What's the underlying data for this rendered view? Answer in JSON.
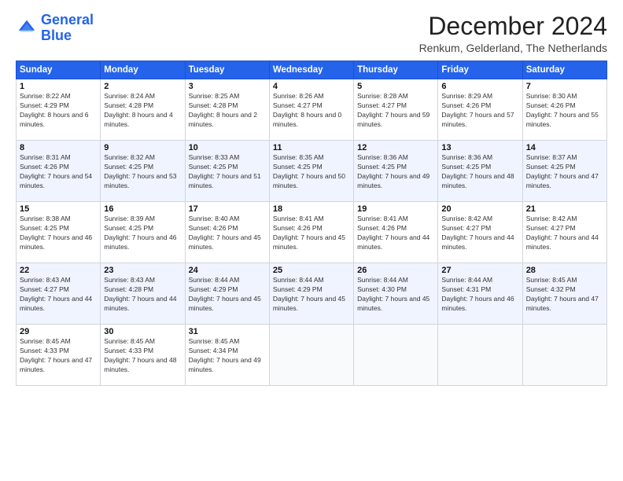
{
  "header": {
    "logo_line1": "General",
    "logo_line2": "Blue",
    "title": "December 2024",
    "location": "Renkum, Gelderland, The Netherlands"
  },
  "days_of_week": [
    "Sunday",
    "Monday",
    "Tuesday",
    "Wednesday",
    "Thursday",
    "Friday",
    "Saturday"
  ],
  "weeks": [
    [
      {
        "day": "1",
        "rise": "8:22 AM",
        "set": "4:29 PM",
        "daylight": "8 hours and 6 minutes."
      },
      {
        "day": "2",
        "rise": "8:24 AM",
        "set": "4:28 PM",
        "daylight": "8 hours and 4 minutes."
      },
      {
        "day": "3",
        "rise": "8:25 AM",
        "set": "4:28 PM",
        "daylight": "8 hours and 2 minutes."
      },
      {
        "day": "4",
        "rise": "8:26 AM",
        "set": "4:27 PM",
        "daylight": "8 hours and 0 minutes."
      },
      {
        "day": "5",
        "rise": "8:28 AM",
        "set": "4:27 PM",
        "daylight": "7 hours and 59 minutes."
      },
      {
        "day": "6",
        "rise": "8:29 AM",
        "set": "4:26 PM",
        "daylight": "7 hours and 57 minutes."
      },
      {
        "day": "7",
        "rise": "8:30 AM",
        "set": "4:26 PM",
        "daylight": "7 hours and 55 minutes."
      }
    ],
    [
      {
        "day": "8",
        "rise": "8:31 AM",
        "set": "4:26 PM",
        "daylight": "7 hours and 54 minutes."
      },
      {
        "day": "9",
        "rise": "8:32 AM",
        "set": "4:25 PM",
        "daylight": "7 hours and 53 minutes."
      },
      {
        "day": "10",
        "rise": "8:33 AM",
        "set": "4:25 PM",
        "daylight": "7 hours and 51 minutes."
      },
      {
        "day": "11",
        "rise": "8:35 AM",
        "set": "4:25 PM",
        "daylight": "7 hours and 50 minutes."
      },
      {
        "day": "12",
        "rise": "8:36 AM",
        "set": "4:25 PM",
        "daylight": "7 hours and 49 minutes."
      },
      {
        "day": "13",
        "rise": "8:36 AM",
        "set": "4:25 PM",
        "daylight": "7 hours and 48 minutes."
      },
      {
        "day": "14",
        "rise": "8:37 AM",
        "set": "4:25 PM",
        "daylight": "7 hours and 47 minutes."
      }
    ],
    [
      {
        "day": "15",
        "rise": "8:38 AM",
        "set": "4:25 PM",
        "daylight": "7 hours and 46 minutes."
      },
      {
        "day": "16",
        "rise": "8:39 AM",
        "set": "4:25 PM",
        "daylight": "7 hours and 46 minutes."
      },
      {
        "day": "17",
        "rise": "8:40 AM",
        "set": "4:26 PM",
        "daylight": "7 hours and 45 minutes."
      },
      {
        "day": "18",
        "rise": "8:41 AM",
        "set": "4:26 PM",
        "daylight": "7 hours and 45 minutes."
      },
      {
        "day": "19",
        "rise": "8:41 AM",
        "set": "4:26 PM",
        "daylight": "7 hours and 44 minutes."
      },
      {
        "day": "20",
        "rise": "8:42 AM",
        "set": "4:27 PM",
        "daylight": "7 hours and 44 minutes."
      },
      {
        "day": "21",
        "rise": "8:42 AM",
        "set": "4:27 PM",
        "daylight": "7 hours and 44 minutes."
      }
    ],
    [
      {
        "day": "22",
        "rise": "8:43 AM",
        "set": "4:27 PM",
        "daylight": "7 hours and 44 minutes."
      },
      {
        "day": "23",
        "rise": "8:43 AM",
        "set": "4:28 PM",
        "daylight": "7 hours and 44 minutes."
      },
      {
        "day": "24",
        "rise": "8:44 AM",
        "set": "4:29 PM",
        "daylight": "7 hours and 45 minutes."
      },
      {
        "day": "25",
        "rise": "8:44 AM",
        "set": "4:29 PM",
        "daylight": "7 hours and 45 minutes."
      },
      {
        "day": "26",
        "rise": "8:44 AM",
        "set": "4:30 PM",
        "daylight": "7 hours and 45 minutes."
      },
      {
        "day": "27",
        "rise": "8:44 AM",
        "set": "4:31 PM",
        "daylight": "7 hours and 46 minutes."
      },
      {
        "day": "28",
        "rise": "8:45 AM",
        "set": "4:32 PM",
        "daylight": "7 hours and 47 minutes."
      }
    ],
    [
      {
        "day": "29",
        "rise": "8:45 AM",
        "set": "4:33 PM",
        "daylight": "7 hours and 47 minutes."
      },
      {
        "day": "30",
        "rise": "8:45 AM",
        "set": "4:33 PM",
        "daylight": "7 hours and 48 minutes."
      },
      {
        "day": "31",
        "rise": "8:45 AM",
        "set": "4:34 PM",
        "daylight": "7 hours and 49 minutes."
      },
      null,
      null,
      null,
      null
    ]
  ],
  "labels": {
    "sunrise": "Sunrise:",
    "sunset": "Sunset:",
    "daylight": "Daylight:"
  }
}
